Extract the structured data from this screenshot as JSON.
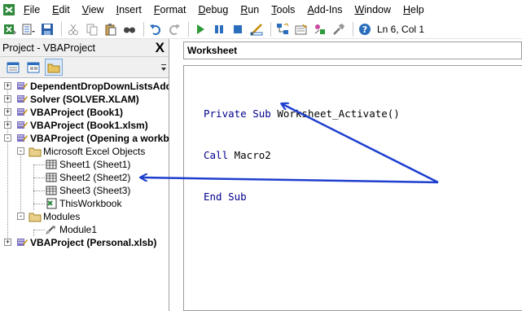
{
  "menu": {
    "items": [
      {
        "u": "F",
        "rest": "ile"
      },
      {
        "u": "E",
        "rest": "dit"
      },
      {
        "u": "V",
        "rest": "iew"
      },
      {
        "u": "I",
        "rest": "nsert"
      },
      {
        "u": "F",
        "rest": "ormat",
        "pre": ""
      },
      {
        "u": "D",
        "rest": "ebug"
      },
      {
        "u": "R",
        "rest": "un"
      },
      {
        "u": "T",
        "rest": "ools"
      },
      {
        "u": "A",
        "rest": "dd-Ins"
      },
      {
        "u": "W",
        "rest": "indow"
      },
      {
        "u": "H",
        "rest": "elp"
      }
    ]
  },
  "toolbar": {
    "icons": [
      "excel-view-icon",
      "insert-module-icon",
      "save-icon",
      "cut-icon",
      "copy-icon",
      "paste-icon",
      "find-icon",
      "undo-icon",
      "redo-icon",
      "run-icon",
      "break-icon",
      "reset-icon",
      "design-mode-icon",
      "project-explorer-icon",
      "properties-icon",
      "object-browser-icon",
      "toolbox-icon",
      "help-icon"
    ],
    "status": "Ln 6, Col 1"
  },
  "project": {
    "title": "Project - VBAProject",
    "close": "X",
    "tree": [
      {
        "label": "DependentDropDownListsAdd",
        "bold": true,
        "level": 0,
        "expander": "+"
      },
      {
        "label": "Solver (SOLVER.XLAM)",
        "bold": true,
        "level": 0,
        "expander": "+"
      },
      {
        "label": "VBAProject (Book1)",
        "bold": true,
        "level": 0,
        "expander": "+"
      },
      {
        "label": "VBAProject (Book1.xlsm)",
        "bold": true,
        "level": 0,
        "expander": "+"
      },
      {
        "label": "VBAProject (Opening a workbo",
        "bold": true,
        "level": 0,
        "expander": "-"
      },
      {
        "label": "Microsoft Excel Objects",
        "bold": false,
        "level": 1,
        "expander": "-"
      },
      {
        "label": "Sheet1 (Sheet1)",
        "bold": false,
        "level": 2
      },
      {
        "label": "Sheet2 (Sheet2)",
        "bold": false,
        "level": 2
      },
      {
        "label": "Sheet3 (Sheet3)",
        "bold": false,
        "level": 2
      },
      {
        "label": "ThisWorkbook",
        "bold": false,
        "level": 2
      },
      {
        "label": "Modules",
        "bold": false,
        "level": 1,
        "expander": "-"
      },
      {
        "label": "Module1",
        "bold": false,
        "level": 2
      },
      {
        "label": "VBAProject (Personal.xlsb)",
        "bold": true,
        "level": 0,
        "expander": "+"
      }
    ]
  },
  "code": {
    "object_combo": "Worksheet",
    "lines": [
      {
        "kw": "Private Sub",
        "tx": " Worksheet_Activate()"
      },
      {
        "kw": "Call",
        "tx": " Macro2"
      },
      {
        "kw": "End Sub",
        "tx": ""
      }
    ]
  },
  "colors": {
    "keyword": "#00008b",
    "arrow": "#1f3fcf"
  }
}
